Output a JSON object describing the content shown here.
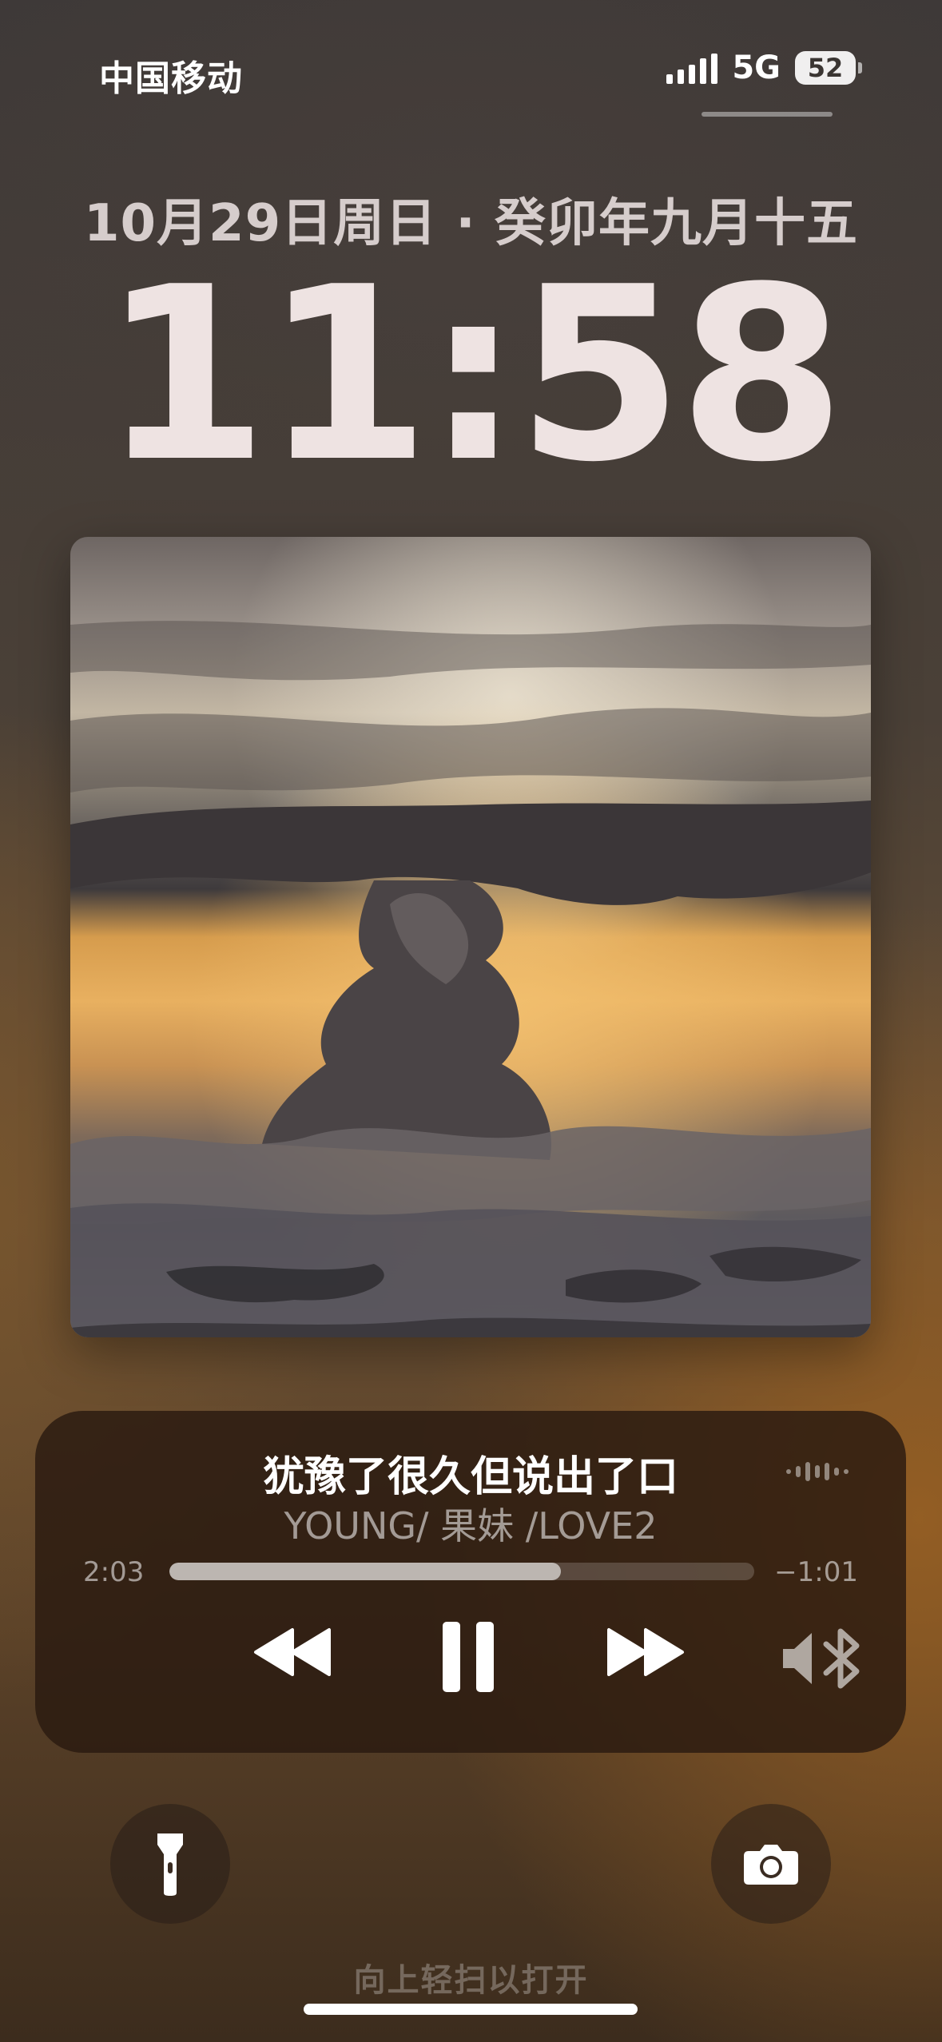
{
  "status_bar": {
    "carrier": "中国移动",
    "network": "5G",
    "battery": "52",
    "icons": [
      "signal-icon",
      "battery-icon"
    ]
  },
  "lock_screen": {
    "date": "10月29日周日 · 癸卯年九月十五",
    "time": "11:58"
  },
  "now_playing": {
    "title": "犹豫了很久但说出了口",
    "artist": "YOUNG/ 果妹 /LOVE2",
    "elapsed": "2:03",
    "remaining": "−1:01",
    "progress_percent": 67,
    "controls": [
      "rewind-icon",
      "pause-icon",
      "fast-forward-icon",
      "bluetooth-audio-icon"
    ]
  },
  "quick_actions": [
    "flashlight-icon",
    "camera-icon"
  ],
  "swipe_hint": "向上轻扫以打开"
}
